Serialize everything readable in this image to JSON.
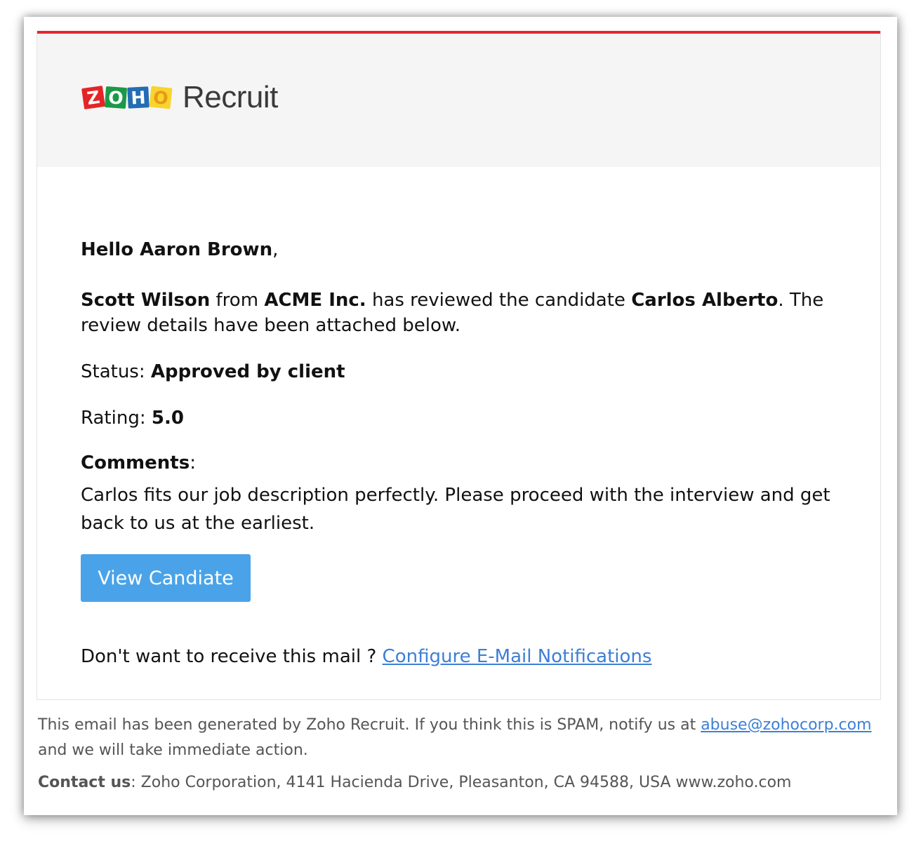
{
  "colors": {
    "accent_bar": "#e4262f",
    "header_bg": "#f5f5f5",
    "button_bg": "#4aa3e8",
    "link": "#3d7fd6",
    "zoho_tiles": [
      "#e42527",
      "#1a9a48",
      "#226db4",
      "#f9d32e"
    ]
  },
  "logo": {
    "letters": [
      "Z",
      "O",
      "H",
      "O"
    ],
    "product": "Recruit"
  },
  "email": {
    "greeting_name": "Hello Aaron Brown",
    "greeting_comma": ",",
    "reviewer": "Scott Wilson",
    "from_text": " from ",
    "company": "ACME Inc.",
    "reviewed_text": " has reviewed the candidate ",
    "candidate": "Carlos Alberto",
    "review_rest": ". The review details have been attached below.",
    "status_label": "Status: ",
    "status_value": "Approved by client",
    "rating_label": "Rating: ",
    "rating_value": "5.0",
    "comments_label": "Comments",
    "comments_colon": ":",
    "comments_text": "Carlos fits our job description perfectly. Please proceed with the interview and get back to us at the earliest.",
    "button_label": "View Candiate",
    "unsubscribe_prompt": "Don't want to receive this mail ? ",
    "unsubscribe_link": "Configure E-Mail Notifications"
  },
  "footer": {
    "spam_text_before": "This email has been generated by Zoho Recruit. If you think this is SPAM, notify us at ",
    "abuse_email": "abuse@zohocorp.com",
    "spam_text_after": " and we will take immediate action.",
    "contact_label": "Contact us",
    "contact_text": ": Zoho Corporation, 4141 Hacienda Drive, Pleasanton, CA 94588, USA www.zoho.com"
  }
}
